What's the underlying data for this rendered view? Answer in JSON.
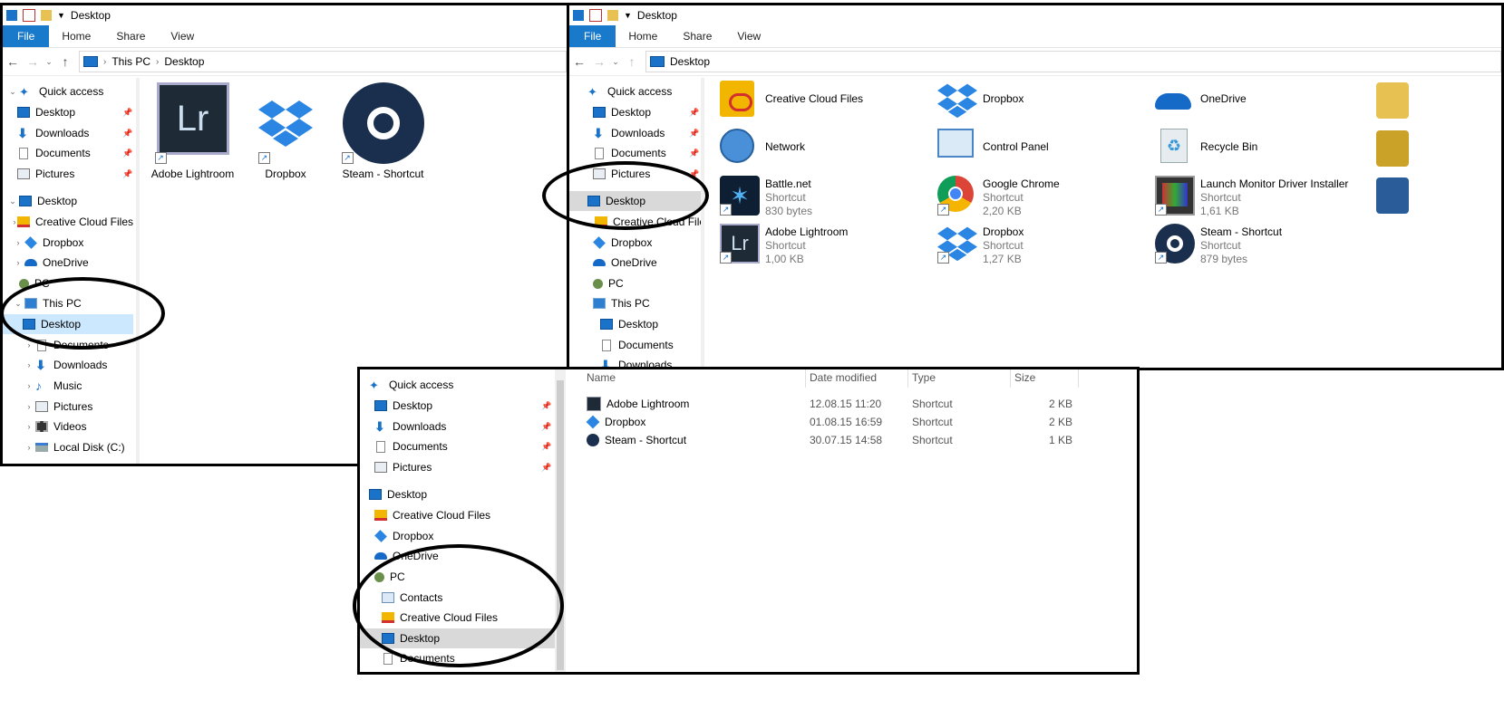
{
  "windows": {
    "left": {
      "title": "Desktop",
      "ribbon": [
        "File",
        "Home",
        "Share",
        "View"
      ],
      "address": {
        "path": [
          "This PC",
          "Desktop"
        ]
      },
      "nav": [
        {
          "label": "Quick access",
          "icon": "star-icon"
        },
        {
          "label": "Desktop",
          "icon": "desktop-icon",
          "pinned": true
        },
        {
          "label": "Downloads",
          "icon": "downloads-icon",
          "pinned": true
        },
        {
          "label": "Documents",
          "icon": "documents-icon",
          "pinned": true
        },
        {
          "label": "Pictures",
          "icon": "pictures-icon",
          "pinned": true
        },
        {
          "label": "Desktop",
          "icon": "desktop-icon"
        },
        {
          "label": "Creative Cloud Files",
          "icon": "creative-cloud-icon"
        },
        {
          "label": "Dropbox",
          "icon": "dropbox-icon"
        },
        {
          "label": "OneDrive",
          "icon": "onedrive-icon"
        },
        {
          "label": "PC",
          "icon": "user-icon"
        },
        {
          "label": "This PC",
          "icon": "this-pc-icon"
        },
        {
          "label": "Desktop",
          "icon": "desktop-icon",
          "selected": true
        },
        {
          "label": "Documents",
          "icon": "documents-icon"
        },
        {
          "label": "Downloads",
          "icon": "downloads-icon"
        },
        {
          "label": "Music",
          "icon": "music-icon"
        },
        {
          "label": "Pictures",
          "icon": "pictures-icon"
        },
        {
          "label": "Videos",
          "icon": "videos-icon"
        },
        {
          "label": "Local Disk (C:)",
          "icon": "disk-icon"
        }
      ],
      "items": [
        {
          "label": "Adobe Lightroom",
          "icon": "lightroom-icon"
        },
        {
          "label": "Dropbox",
          "icon": "dropbox-icon"
        },
        {
          "label": "Steam - Shortcut",
          "icon": "steam-icon"
        }
      ]
    },
    "right": {
      "title": "Desktop",
      "ribbon": [
        "File",
        "Home",
        "Share",
        "View"
      ],
      "address": {
        "path": [
          "Desktop"
        ]
      },
      "nav": [
        {
          "label": "Quick access",
          "icon": "star-icon"
        },
        {
          "label": "Desktop",
          "icon": "desktop-icon",
          "pinned": true
        },
        {
          "label": "Downloads",
          "icon": "downloads-icon",
          "pinned": true
        },
        {
          "label": "Documents",
          "icon": "documents-icon",
          "pinned": true
        },
        {
          "label": "Pictures",
          "icon": "pictures-icon",
          "pinned": true
        },
        {
          "label": "Desktop",
          "icon": "desktop-icon",
          "selected": true
        },
        {
          "label": "Creative Cloud Files",
          "icon": "creative-cloud-icon"
        },
        {
          "label": "Dropbox",
          "icon": "dropbox-icon"
        },
        {
          "label": "OneDrive",
          "icon": "onedrive-icon"
        },
        {
          "label": "PC",
          "icon": "user-icon"
        },
        {
          "label": "This PC",
          "icon": "this-pc-icon"
        },
        {
          "label": "Desktop",
          "icon": "desktop-icon"
        },
        {
          "label": "Documents",
          "icon": "documents-icon"
        },
        {
          "label": "Downloads",
          "icon": "downloads-icon"
        }
      ],
      "tiles": [
        {
          "name": "Creative Cloud Files",
          "type": "",
          "size": "",
          "icon": "creative-cloud-icon"
        },
        {
          "name": "Dropbox",
          "type": "",
          "size": "",
          "icon": "dropbox-icon"
        },
        {
          "name": "OneDrive",
          "type": "",
          "size": "",
          "icon": "onedrive-icon"
        },
        {
          "name": "Network",
          "type": "",
          "size": "",
          "icon": "network-icon"
        },
        {
          "name": "Control Panel",
          "type": "",
          "size": "",
          "icon": "control-panel-icon"
        },
        {
          "name": "Recycle Bin",
          "type": "",
          "size": "",
          "icon": "recycle-bin-icon"
        },
        {
          "name": "Battle.net",
          "type": "Shortcut",
          "size": "830 bytes",
          "icon": "battlenet-icon"
        },
        {
          "name": "Google Chrome",
          "type": "Shortcut",
          "size": "2,20 KB",
          "icon": "chrome-icon"
        },
        {
          "name": "Launch Monitor Driver Installer",
          "type": "Shortcut",
          "size": "1,61 KB",
          "icon": "installer-icon"
        },
        {
          "name": "Adobe Lightroom",
          "type": "Shortcut",
          "size": "1,00 KB",
          "icon": "lightroom-icon"
        },
        {
          "name": "Dropbox",
          "type": "Shortcut",
          "size": "1,27 KB",
          "icon": "dropbox-icon"
        },
        {
          "name": "Steam - Shortcut",
          "type": "Shortcut",
          "size": "879 bytes",
          "icon": "steam-icon"
        }
      ]
    },
    "bottom": {
      "nav": [
        {
          "label": "Quick access",
          "icon": "star-icon"
        },
        {
          "label": "Desktop",
          "icon": "desktop-icon",
          "pinned": true
        },
        {
          "label": "Downloads",
          "icon": "downloads-icon",
          "pinned": true
        },
        {
          "label": "Documents",
          "icon": "documents-icon",
          "pinned": true
        },
        {
          "label": "Pictures",
          "icon": "pictures-icon",
          "pinned": true
        },
        {
          "label": "Desktop",
          "icon": "desktop-icon"
        },
        {
          "label": "Creative Cloud Files",
          "icon": "creative-cloud-icon"
        },
        {
          "label": "Dropbox",
          "icon": "dropbox-icon"
        },
        {
          "label": "OneDrive",
          "icon": "onedrive-icon"
        },
        {
          "label": "PC",
          "icon": "user-icon"
        },
        {
          "label": "Contacts",
          "icon": "contacts-icon"
        },
        {
          "label": "Creative Cloud Files",
          "icon": "creative-cloud-icon"
        },
        {
          "label": "Desktop",
          "icon": "desktop-icon",
          "selected": true
        },
        {
          "label": "Documents",
          "icon": "documents-icon"
        }
      ],
      "columns": [
        "Name",
        "Date modified",
        "Type",
        "Size"
      ],
      "rows": [
        {
          "name": "Adobe Lightroom",
          "date": "12.08.15 11:20",
          "type": "Shortcut",
          "size": "2 KB",
          "icon": "lightroom-icon"
        },
        {
          "name": "Dropbox",
          "date": "01.08.15 16:59",
          "type": "Shortcut",
          "size": "2 KB",
          "icon": "dropbox-icon"
        },
        {
          "name": "Steam - Shortcut",
          "date": "30.07.15 14:58",
          "type": "Shortcut",
          "size": "1 KB",
          "icon": "steam-icon"
        }
      ]
    }
  },
  "colors": {
    "accent": "#1979ca",
    "selection": "#cce8ff",
    "grey_selection": "#d9d9d9"
  }
}
